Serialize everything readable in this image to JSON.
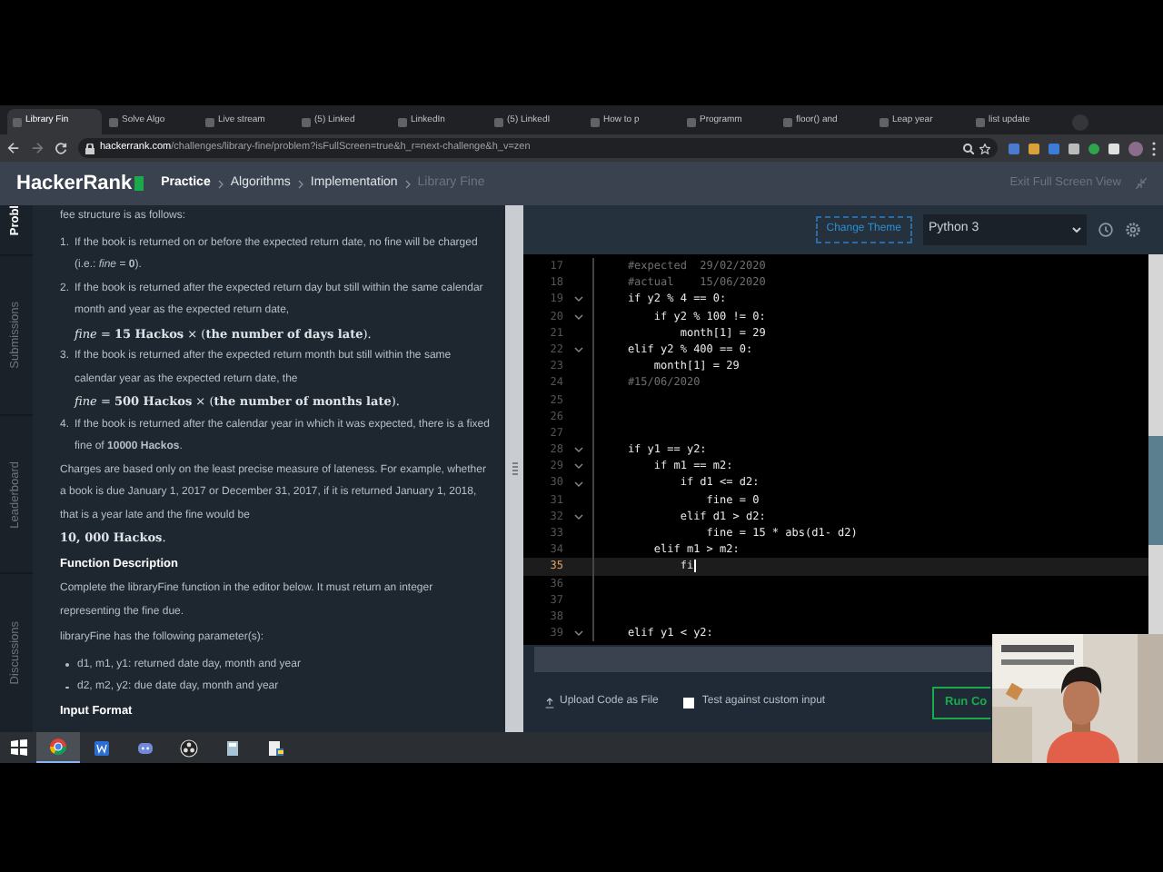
{
  "browser": {
    "tabs": [
      {
        "title": "Library Fin",
        "selected": true
      },
      {
        "title": "Solve Algo",
        "selected": false
      },
      {
        "title": "Live stream",
        "selected": false
      },
      {
        "title": "(5) Linked",
        "selected": false
      },
      {
        "title": "LinkedIn",
        "selected": false
      },
      {
        "title": "(5) LinkedI",
        "selected": false
      },
      {
        "title": "How to p",
        "selected": false
      },
      {
        "title": "Programm",
        "selected": false
      },
      {
        "title": "floor() and",
        "selected": false
      },
      {
        "title": "Leap year",
        "selected": false
      },
      {
        "title": "list update",
        "selected": false
      }
    ],
    "address": {
      "domain": "hackerrank.com",
      "path": "/challenges/library-fine/problem?isFullScreen=true&h_r=next-challenge&h_v=zen"
    }
  },
  "header": {
    "logo": "HackerRank",
    "breadcrumbs": [
      "Practice",
      "Algorithms",
      "Implementation",
      "Library Fine"
    ],
    "exit_link": "Exit Full Screen View"
  },
  "side_tabs": [
    {
      "label": "Probl",
      "selected": true
    },
    {
      "label": "Submissions",
      "selected": false
    },
    {
      "label": "Leaderboard",
      "selected": false
    },
    {
      "label": "Discussions",
      "selected": false
    }
  ],
  "problem": [
    {
      "kind": "para",
      "text": "fee structure is as follows:"
    },
    {
      "kind": "ol",
      "number": "1.",
      "text": "If the book is returned on or before the expected return date, no fine will be charged (i.e.: *fine* = **0**)."
    },
    {
      "kind": "ol",
      "number": "2.",
      "text": "If the book is returned after the expected return day but still within the same calendar month and year as the expected return date,",
      "formula": "*fine* = **15 Hackos** × (**the number of days late**)."
    },
    {
      "kind": "ol",
      "number": "3.",
      "text": "If the book is returned after the expected return month but still within the same calendar year as the expected return date, the",
      "formula": "*fine* = **500 Hackos** × (**the number of months late**)."
    },
    {
      "kind": "ol",
      "number": "4.",
      "text": "If the book is returned after the calendar year in which it was expected, there is a fixed fine of **10000 Hackos**."
    },
    {
      "kind": "para",
      "text": "Charges are based only on the least precise measure of lateness. For example, whether a book is due January 1, 2017 or December 31, 2017, if it is returned January 1, 2018, that is a year late and the fine would be",
      "formula": "**10, 000 Hackos**."
    },
    {
      "kind": "heading",
      "text": "Function Description"
    },
    {
      "kind": "para",
      "text": "Complete the libraryFine function in the editor below. It must return an integer representing the fine due."
    },
    {
      "kind": "para",
      "text": "libraryFine has the following parameter(s):"
    },
    {
      "kind": "bullet",
      "text": "d1, m1, y1: returned date day, month and year"
    },
    {
      "kind": "bullet",
      "text": "d2, m2, y2: due date day, month and year"
    },
    {
      "kind": "heading",
      "text": "Input Format"
    }
  ],
  "editor": {
    "theme_button": "Change Theme",
    "language": "Python 3",
    "lines": [
      {
        "number": "17",
        "text": "    #expected  29/02/2020",
        "kind": "comment",
        "fold": false,
        "current": false
      },
      {
        "number": "18",
        "text": "    #actual    15/06/2020",
        "kind": "comment",
        "fold": false,
        "current": false
      },
      {
        "number": "19",
        "text": "    if y2 % 4 == 0:",
        "kind": "code",
        "fold": true,
        "current": false
      },
      {
        "number": "20",
        "text": "        if y2 % 100 != 0:",
        "kind": "code",
        "fold": true,
        "current": false
      },
      {
        "number": "21",
        "text": "            month[1] = 29",
        "kind": "code",
        "fold": false,
        "current": false
      },
      {
        "number": "22",
        "text": "    elif y2 % 400 == 0:",
        "kind": "code",
        "fold": true,
        "current": false
      },
      {
        "number": "23",
        "text": "        month[1] = 29",
        "kind": "code",
        "fold": false,
        "current": false
      },
      {
        "number": "24",
        "text": "    #15/06/2020",
        "kind": "comment",
        "fold": false,
        "current": false
      },
      {
        "number": "25",
        "fold": false,
        "current": false
      },
      {
        "number": "26",
        "fold": false,
        "current": false
      },
      {
        "number": "27",
        "fold": false,
        "current": false
      },
      {
        "number": "28",
        "text": "    if y1 == y2:",
        "kind": "code",
        "fold": true,
        "current": false
      },
      {
        "number": "29",
        "text": "        if m1 == m2:",
        "kind": "code",
        "fold": true,
        "current": false
      },
      {
        "number": "30",
        "text": "            if d1 <= d2:",
        "kind": "code",
        "fold": true,
        "current": false
      },
      {
        "number": "31",
        "text": "                fine = 0",
        "kind": "code",
        "fold": false,
        "current": false
      },
      {
        "number": "32",
        "text": "            elif d1 > d2:",
        "kind": "code",
        "fold": true,
        "current": false
      },
      {
        "number": "33",
        "text": "                fine = 15 * abs(d1- d2)",
        "kind": "code",
        "fold": false,
        "current": false
      },
      {
        "number": "34",
        "text": "        elif m1 > m2:",
        "kind": "code",
        "fold": false,
        "current": false
      },
      {
        "number": "35",
        "text": "            fi",
        "kind": "code",
        "fold": false,
        "current": true
      },
      {
        "number": "36",
        "fold": false,
        "current": false
      },
      {
        "number": "37",
        "fold": false,
        "current": false
      },
      {
        "number": "38",
        "fold": false,
        "current": false
      },
      {
        "number": "39",
        "text": "    elif y1 < y2:",
        "kind": "code",
        "fold": true,
        "current": false
      }
    ]
  },
  "footer": {
    "upload": "Upload Code as File",
    "custom_input": {
      "label": "Test against custom input",
      "checked": false
    },
    "run_button": "Run Co"
  },
  "taskbar": {
    "apps": [
      {
        "kind": "chrome",
        "selected": true
      },
      {
        "kind": "word",
        "selected": false
      },
      {
        "kind": "discord",
        "selected": false
      },
      {
        "kind": "obs",
        "selected": false
      },
      {
        "kind": "calculator",
        "selected": false
      },
      {
        "kind": "python",
        "selected": false
      }
    ]
  }
}
